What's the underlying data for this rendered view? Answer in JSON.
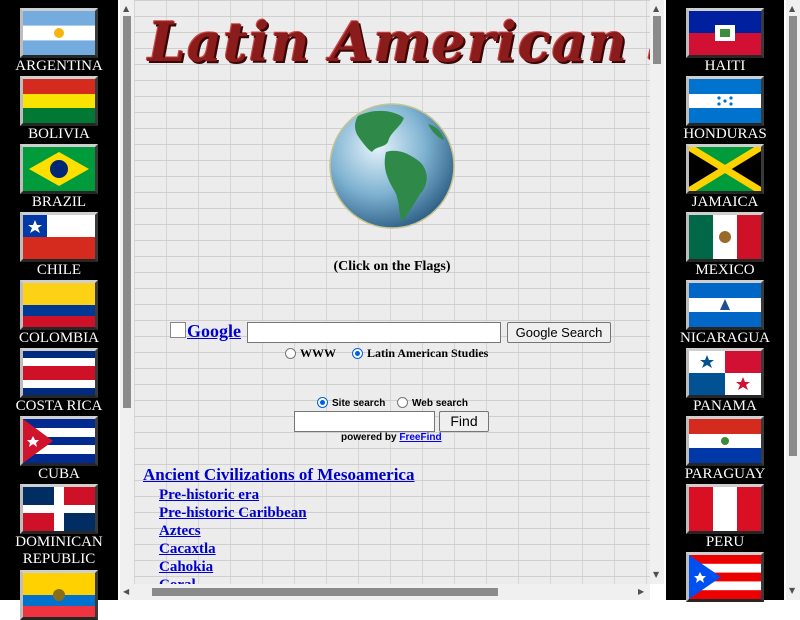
{
  "header": {
    "title": "Latin American S"
  },
  "click_note": "(Click on the Flags)",
  "google": {
    "logo_alt": "Google",
    "search_value": "",
    "search_button": "Google Search",
    "option_www": "WWW",
    "option_site": "Latin American Studies",
    "selected": "Latin American Studies"
  },
  "freefind": {
    "option_site": "Site search",
    "option_web": "Web search",
    "search_value": "",
    "find_button": "Find",
    "powered_by": "powered by",
    "powered_link": "FreeFind"
  },
  "section": {
    "heading": "Ancient Civilizations of Mesoamerica",
    "links": [
      "Pre-historic era",
      "Pre-historic Caribbean",
      "Aztecs",
      "Cacaxtla",
      "Cahokia",
      "Coral"
    ]
  },
  "left_flags": [
    {
      "label": "ARGENTINA",
      "icon": "argentina-flag-icon"
    },
    {
      "label": "BOLIVIA",
      "icon": "bolivia-flag-icon"
    },
    {
      "label": "BRAZIL",
      "icon": "brazil-flag-icon"
    },
    {
      "label": "CHILE",
      "icon": "chile-flag-icon"
    },
    {
      "label": "COLOMBIA",
      "icon": "colombia-flag-icon"
    },
    {
      "label": "COSTA RICA",
      "icon": "costa-rica-flag-icon"
    },
    {
      "label": "CUBA",
      "icon": "cuba-flag-icon"
    },
    {
      "label": "DOMINICAN",
      "label2": "REPUBLIC",
      "icon": "dominican-republic-flag-icon"
    },
    {
      "label": "",
      "icon": "ecuador-flag-icon"
    }
  ],
  "right_flags": [
    {
      "label": "HAITI",
      "icon": "haiti-flag-icon"
    },
    {
      "label": "HONDURAS",
      "icon": "honduras-flag-icon"
    },
    {
      "label": "JAMAICA",
      "icon": "jamaica-flag-icon"
    },
    {
      "label": "MEXICO",
      "icon": "mexico-flag-icon"
    },
    {
      "label": "NICARAGUA",
      "icon": "nicaragua-flag-icon"
    },
    {
      "label": "PANAMA",
      "icon": "panama-flag-icon"
    },
    {
      "label": "PARAGUAY",
      "icon": "paraguay-flag-icon"
    },
    {
      "label": "PERU",
      "icon": "peru-flag-icon"
    },
    {
      "label": "",
      "icon": "puerto-rico-flag-icon"
    }
  ],
  "colors": {
    "link": "#0000cc",
    "title": "#8b1c1c",
    "frame": "#000000"
  }
}
